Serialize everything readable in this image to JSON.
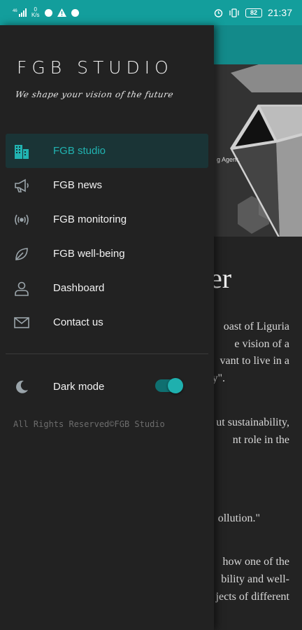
{
  "status_bar": {
    "left_icons": [
      "signal-icon",
      "data-speed-icon",
      "spotify-icon",
      "warning-icon",
      "app-icon"
    ],
    "data_speed_top": "0",
    "data_speed_unit": "K/s",
    "signal_label": "46",
    "battery": "82",
    "time": "21:37"
  },
  "background_page": {
    "hero_caption": "g Agent.",
    "title_fragment": "er",
    "text_lines": [
      "oast of Liguria",
      "e vision of a",
      "vant to live in a",
      "y\".",
      "ut sustainability,",
      "nt role in the",
      "ollution.\"",
      "how one of the",
      "bility and well-",
      "jects of different"
    ]
  },
  "drawer": {
    "logo": "FGB STUDIO",
    "tagline": "We shape your vision of the future",
    "menu": [
      {
        "label": "FGB studio",
        "icon": "building-icon",
        "active": true
      },
      {
        "label": "FGB news",
        "icon": "megaphone-icon",
        "active": false
      },
      {
        "label": "FGB monitoring",
        "icon": "broadcast-icon",
        "active": false
      },
      {
        "label": "FGB well-being",
        "icon": "leaf-icon",
        "active": false
      },
      {
        "label": "Dashboard",
        "icon": "person-icon",
        "active": false
      },
      {
        "label": "Contact us",
        "icon": "mail-icon",
        "active": false
      }
    ],
    "dark_mode": {
      "label": "Dark mode",
      "icon": "moon-icon",
      "enabled": true
    },
    "footer": "All Rights Reserved©FGB Studio"
  },
  "colors": {
    "accent": "#21b3b1",
    "status_bar": "#139e9c",
    "drawer_bg": "#222222",
    "active_bg": "#1a3436"
  }
}
